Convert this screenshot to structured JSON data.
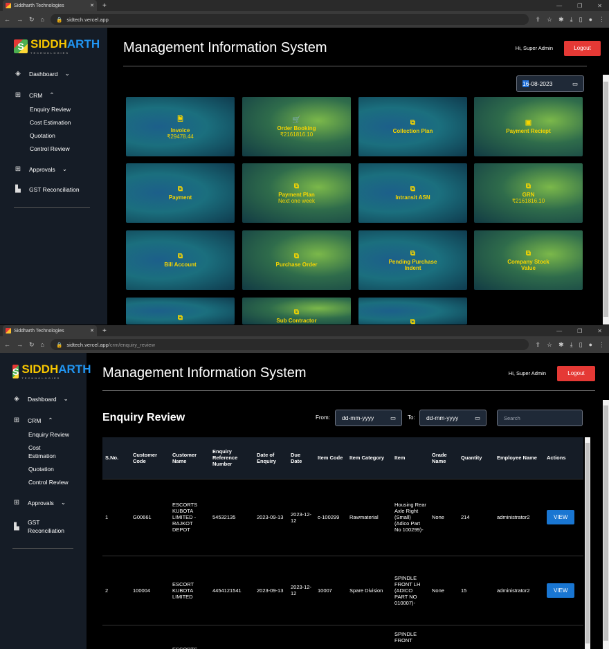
{
  "browser": {
    "tab_title": "Siddharth Technologies",
    "url_top": "sidtech.vercel.app",
    "url_bottom_host": "sidtech.vercel.app",
    "url_bottom_path": "/crm/enquiry_review"
  },
  "logo": {
    "part1": "SIDDH",
    "part2": "ARTH",
    "sub": "TECHNOLOGIES"
  },
  "sidebar": {
    "dashboard": "Dashboard",
    "crm": "CRM",
    "crm_items": [
      "Enquiry Review",
      "Cost Estimation",
      "Quotation",
      "Control Review"
    ],
    "crm_items_bottom": [
      "Enquiry Review",
      "Cost",
      "Estimation",
      "Quotation",
      "Control Review"
    ],
    "approvals": "Approvals",
    "gst": "GST Reconciliation",
    "gst_line1": "GST",
    "gst_line2": "Reconciliation"
  },
  "header": {
    "title": "Management Information System",
    "greeting": "Hi, Super Admin",
    "logout": "Logout"
  },
  "dashboard": {
    "date_day": "16",
    "date_rest": "-08-2023",
    "cards": [
      {
        "label": "Invoice",
        "sub": "₹29478.44"
      },
      {
        "label": "Order Booking",
        "sub": "₹2161816.10"
      },
      {
        "label": "Collection Plan",
        "sub": ""
      },
      {
        "label": "Payment Reciept",
        "sub": ""
      },
      {
        "label": "Payment",
        "sub": ""
      },
      {
        "label": "Payment Plan",
        "sub": "Next one week"
      },
      {
        "label": "Intransit ASN",
        "sub": ""
      },
      {
        "label": "GRN",
        "sub": "₹2161816.10"
      },
      {
        "label": "Bill Account",
        "sub": ""
      },
      {
        "label": "Purchase Order",
        "sub": ""
      },
      {
        "label": "Pending Purchase Indent",
        "sub": ""
      },
      {
        "label": "Company Stock Value",
        "sub": ""
      },
      {
        "label": "",
        "sub": ""
      },
      {
        "label": "Sub Contractor",
        "sub": ""
      },
      {
        "label": "",
        "sub": ""
      }
    ]
  },
  "enquiry": {
    "title": "Enquiry Review",
    "from": "From:",
    "to": "To:",
    "date_placeholder": "dd-mm-yyyy",
    "search_placeholder": "Search",
    "columns": [
      "S.No.",
      "Customer Code",
      "Customer Name",
      "Enquiry Reference Number",
      "Date of Enquiry",
      "Due Date",
      "Item Code",
      "Item Category",
      "Item",
      "Grade Name",
      "Quantity",
      "Employee Name",
      "Actions"
    ],
    "rows": [
      {
        "sno": "1",
        "code": "G00661",
        "name": "ESCORTS KUBOTA LIMITED - RAJKOT DEPOT",
        "ref": "54532135",
        "date": "2023-09-13",
        "due": "2023-12-12",
        "icode": "c-100299",
        "cat": "Rawmaterial",
        "item": "Housing Rear Axle Right (Small) (Adico Part No 100299)-",
        "grade": "None",
        "qty": "214",
        "emp": "administrator2",
        "action": "VIEW"
      },
      {
        "sno": "2",
        "code": "100004",
        "name": "ESCORT KUBOTA LIMITED",
        "ref": "4454121541",
        "date": "2023-09-13",
        "due": "2023-12-12",
        "icode": "10007",
        "cat": "Spare Division",
        "item": "SPINDLE FRONT LH (ADICO PART NO 010007)-",
        "grade": "None",
        "qty": "15",
        "emp": "administrator2",
        "action": "VIEW"
      },
      {
        "sno": "",
        "code": "",
        "name": "ESCORTS",
        "ref": "",
        "date": "",
        "due": "",
        "icode": "",
        "cat": "",
        "item": "SPINDLE FRONT",
        "grade": "",
        "qty": "",
        "emp": "",
        "action": ""
      }
    ]
  }
}
